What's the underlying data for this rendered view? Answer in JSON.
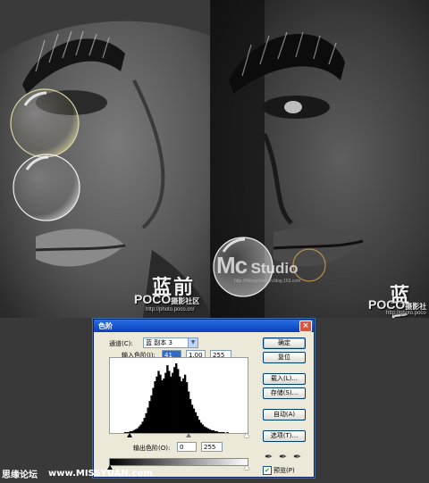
{
  "photos": {
    "left": {
      "title": "蓝前",
      "brand": "POCO",
      "brand_sub": "摄影社区",
      "url": "http://photo.poco.cn/"
    },
    "right": {
      "title": "蓝后",
      "brand": "POCO",
      "brand_sub": "摄影社",
      "url": "http://photo.poco"
    },
    "overlay": {
      "mc": "Mc",
      "studio": "Studio",
      "url": "http://Mengchenmh.blog.163.com"
    }
  },
  "dialog": {
    "title": "色阶",
    "channel_label": "通道(C):",
    "channel_value": "蓝 副本 3",
    "input_levels_label": "输入色阶(I):",
    "input_levels": [
      "41",
      "1.00",
      "255"
    ],
    "output_levels_label": "输出色阶(O):",
    "output_levels": [
      "0",
      "255"
    ],
    "buttons": {
      "ok": "确定",
      "reset": "复位",
      "load": "载入(L)...",
      "save": "存储(S)...",
      "auto": "自动(A)",
      "options": "选项(T)..."
    },
    "preview_label": "预览(P)",
    "preview_checked": true,
    "histogram": [
      0,
      0,
      0,
      0,
      0,
      0,
      0,
      0,
      1,
      1,
      1,
      2,
      2,
      3,
      4,
      5,
      7,
      9,
      12,
      16,
      21,
      27,
      34,
      40,
      48,
      55,
      60,
      66,
      62,
      56,
      58,
      64,
      72,
      66,
      60,
      64,
      70,
      74,
      68,
      60,
      55,
      58,
      62,
      54,
      44,
      36,
      30,
      26,
      22,
      18,
      14,
      11,
      9,
      7,
      6,
      5,
      4,
      3,
      3,
      2,
      2,
      1,
      1,
      1,
      1,
      0,
      1,
      0,
      0,
      0,
      0,
      0,
      0,
      0,
      0,
      0,
      0,
      0
    ]
  },
  "footer": {
    "site_name": "思缘论坛",
    "site_url": "www.MISSYUAN.com"
  }
}
